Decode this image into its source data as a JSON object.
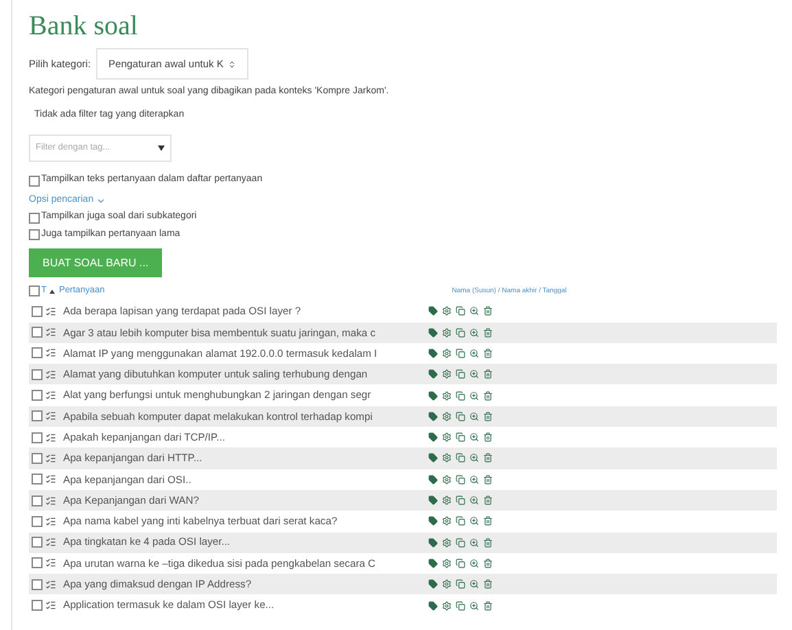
{
  "title": "Bank soal",
  "category": {
    "label": "Pilih kategori:",
    "value": "Pengaturan awal untuk K"
  },
  "description": "Kategori pengaturan awal untuk soal yang dibagikan pada konteks 'Kompre Jarkom'.",
  "tag_status": "Tidak ada filter tag yang diterapkan",
  "tag_filter": {
    "placeholder": "Filter dengan tag..."
  },
  "show_text_option": {
    "label": "Tampilkan teks pertanyaan dalam daftar pertanyaan",
    "checked": false
  },
  "search_options": {
    "label": "Opsi pencarian",
    "options": [
      {
        "label": "Tampilkan juga soal dari subkategori",
        "checked": false
      },
      {
        "label": "Juga tampilkan pertanyaan lama",
        "checked": false
      }
    ]
  },
  "create_button": "BUAT SOAL BARU ...",
  "table": {
    "select_all": false,
    "type_sort": "T",
    "question_sort": "Pertanyaan",
    "author_sort": "Nama (Susun) / Nama akhir / Tanggal",
    "rows": [
      {
        "text": "Ada berapa lapisan yang terdapat pada OSI layer ?",
        "checked": false
      },
      {
        "text": "Agar 3 atau lebih komputer bisa membentuk suatu jaringan, maka c",
        "checked": false
      },
      {
        "text": "Alamat IP yang menggunakan alamat 192.0.0.0 termasuk kedalam I",
        "checked": false
      },
      {
        "text": "Alamat yang dibutuhkan komputer untuk saling terhubung dengan",
        "checked": false
      },
      {
        "text": "Alat yang berfungsi untuk menghubungkan 2 jaringan dengan segr",
        "checked": false
      },
      {
        "text": "Apabila sebuah komputer dapat melakukan kontrol terhadap kompi",
        "checked": false
      },
      {
        "text": "Apakah kepanjangan dari TCP/IP...",
        "checked": false
      },
      {
        "text": "Apa kepanjangan dari HTTP...",
        "checked": false
      },
      {
        "text": "Apa kepanjangan dari OSI..",
        "checked": false
      },
      {
        "text": "Apa Kepanjangan dari WAN?",
        "checked": false
      },
      {
        "text": "Apa nama kabel yang inti kabelnya terbuat dari serat kaca?",
        "checked": false
      },
      {
        "text": "Apa tingkatan ke 4 pada OSI layer...",
        "checked": false
      },
      {
        "text": "Apa urutan warna ke –tiga dikedua sisi pada pengkabelan secara C",
        "checked": false
      },
      {
        "text": "Apa yang dimaksud dengan IP Address?",
        "checked": false
      },
      {
        "text": "Application termasuk ke dalam OSI layer ke...",
        "checked": false
      }
    ]
  }
}
